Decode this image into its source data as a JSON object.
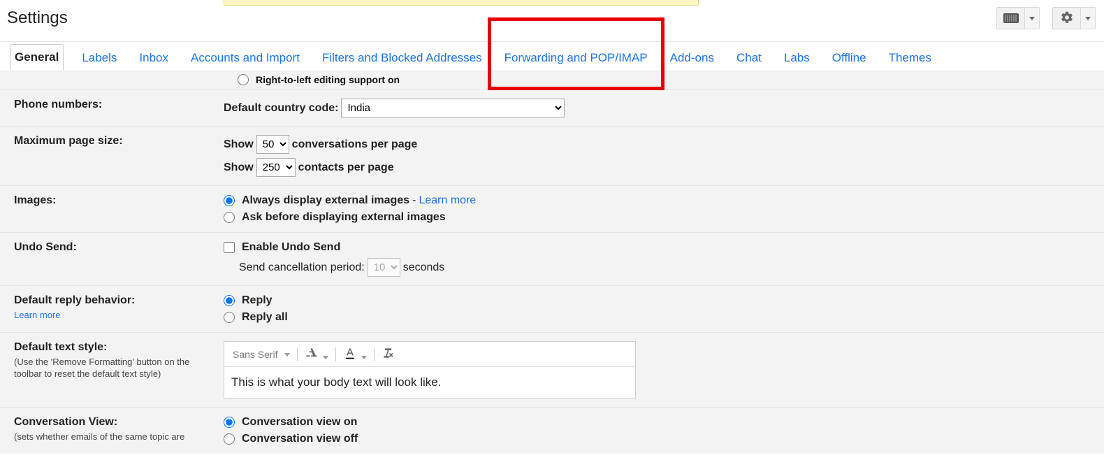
{
  "header": {
    "title": "Settings"
  },
  "tabs": [
    {
      "id": "general",
      "label": "General",
      "active": true
    },
    {
      "id": "labels",
      "label": "Labels"
    },
    {
      "id": "inbox",
      "label": "Inbox"
    },
    {
      "id": "accounts",
      "label": "Accounts and Import"
    },
    {
      "id": "filters",
      "label": "Filters and Blocked Addresses"
    },
    {
      "id": "forwarding",
      "label": "Forwarding and POP/IMAP",
      "highlighted": true
    },
    {
      "id": "addons",
      "label": "Add-ons"
    },
    {
      "id": "chat",
      "label": "Chat"
    },
    {
      "id": "labs",
      "label": "Labs"
    },
    {
      "id": "offline",
      "label": "Offline"
    },
    {
      "id": "themes",
      "label": "Themes"
    }
  ],
  "truncated_row": {
    "partial_radio_label": "Right-to-left editing support on"
  },
  "phone_numbers": {
    "label": "Phone numbers:",
    "field_label": "Default country code:",
    "selected": "India"
  },
  "page_size": {
    "label": "Maximum page size:",
    "show_word": "Show",
    "conv_value": "50",
    "conv_suffix": "conversations per page",
    "contacts_value": "250",
    "contacts_suffix": "contacts per page"
  },
  "images": {
    "label": "Images:",
    "opt_always": "Always display external images",
    "dash": " - ",
    "learn_more": "Learn more",
    "opt_ask": "Ask before displaying external images",
    "selected": "always"
  },
  "undo_send": {
    "label": "Undo Send:",
    "checkbox_label": "Enable Undo Send",
    "period_label": "Send cancellation period:",
    "period_value": "10",
    "seconds": "seconds",
    "enabled": false
  },
  "reply": {
    "label": "Default reply behavior:",
    "learn_more": "Learn more",
    "opt_reply": "Reply",
    "opt_reply_all": "Reply all",
    "selected": "reply"
  },
  "text_style": {
    "label": "Default text style:",
    "hint": "(Use the 'Remove Formatting' button on the toolbar to reset the default text style)",
    "font_name": "Sans Serif",
    "preview": "This is what your body text will look like."
  },
  "conversation": {
    "label": "Conversation View:",
    "hint_partial": "(sets whether emails of the same topic are",
    "opt_on": "Conversation view on",
    "opt_off": "Conversation view off",
    "selected": "on"
  }
}
